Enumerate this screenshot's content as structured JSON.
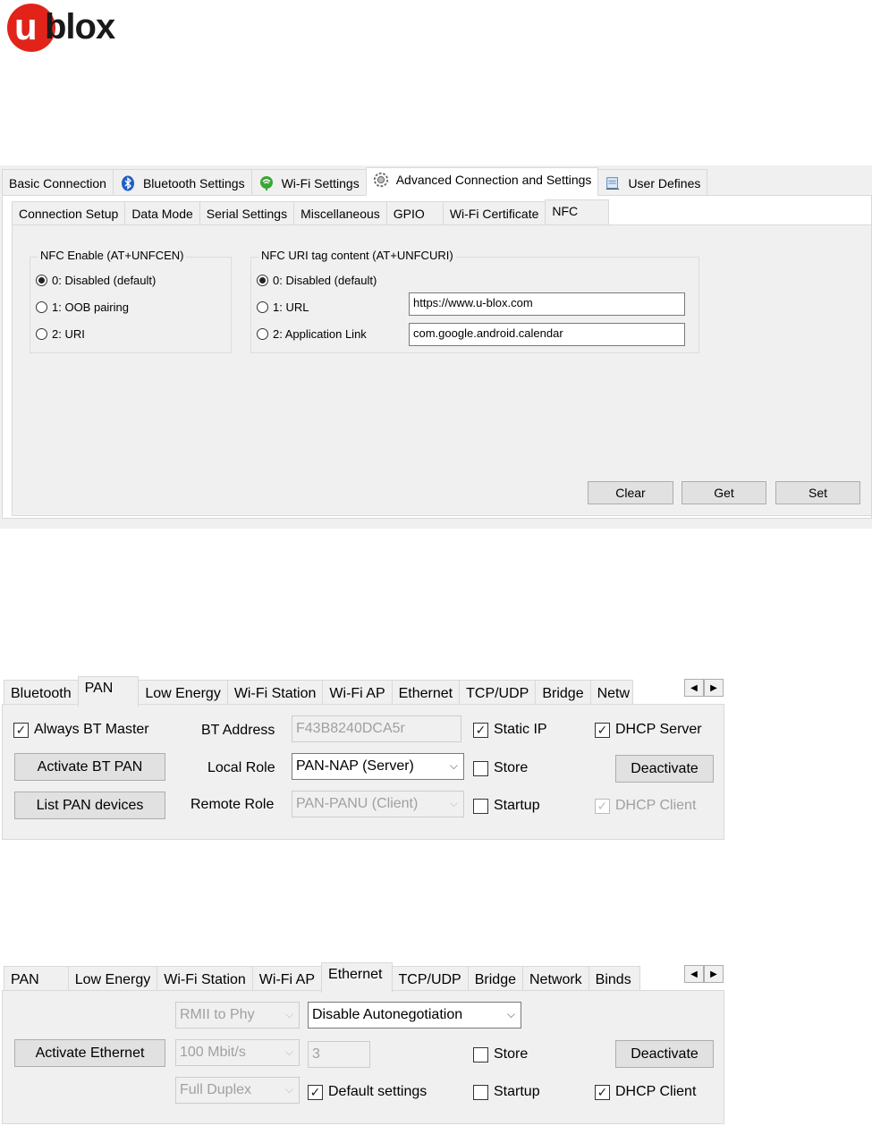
{
  "logo": {
    "text": "blox",
    "u": "u"
  },
  "panel1": {
    "tabs": [
      {
        "label": "Basic Connection",
        "icon": ""
      },
      {
        "label": "Bluetooth Settings",
        "icon": "bluetooth-icon"
      },
      {
        "label": "Wi-Fi Settings",
        "icon": "wifi-icon"
      },
      {
        "label": "Advanced Connection and Settings",
        "icon": "gear-icon"
      },
      {
        "label": "User Defines",
        "icon": "notepad-icon"
      }
    ],
    "subtabs": [
      "Connection Setup",
      "Data Mode",
      "Serial Settings",
      "Miscellaneous",
      "GPIO",
      "Wi-Fi Certificate",
      "NFC"
    ],
    "nfc_enable": {
      "title": "NFC Enable (AT+UNFCEN)",
      "options": [
        "0: Disabled (default)",
        "1: OOB pairing",
        "2: URI"
      ],
      "selected": 0
    },
    "nfc_uri": {
      "title": "NFC URI tag content (AT+UNFCURI)",
      "options": [
        "0: Disabled (default)",
        "1: URL",
        "2: Application Link"
      ],
      "selected": 0,
      "url_value": "https://www.u-blox.com",
      "app_link_value": "com.google.android.calendar"
    },
    "buttons": {
      "clear": "Clear",
      "get": "Get",
      "set": "Set"
    }
  },
  "panel2": {
    "tabs": [
      "Bluetooth",
      "PAN",
      "Low Energy",
      "Wi-Fi Station",
      "Wi-Fi AP",
      "Ethernet",
      "TCP/UDP",
      "Bridge",
      "Netw"
    ],
    "always_bt_master": "Always BT Master",
    "activate_bt_pan": "Activate BT PAN",
    "list_pan_devices": "List PAN devices",
    "bt_address_label": "BT Address",
    "bt_address_value": "F43B8240DCA5r",
    "local_role_label": "Local Role",
    "local_role_value": "PAN-NAP (Server)",
    "remote_role_label": "Remote Role",
    "remote_role_value": "PAN-PANU (Client)",
    "static_ip": "Static IP",
    "store": "Store",
    "startup": "Startup",
    "dhcp_server": "DHCP Server",
    "deactivate": "Deactivate",
    "dhcp_client": "DHCP Client"
  },
  "panel3": {
    "tabs": [
      "PAN",
      "Low Energy",
      "Wi-Fi Station",
      "Wi-Fi AP",
      "Ethernet",
      "TCP/UDP",
      "Bridge",
      "Network",
      "Binds"
    ],
    "rmii_value": "RMII to Phy",
    "autoneg_value": "Disable Autonegotiation",
    "activate_ethernet": "Activate Ethernet",
    "speed_value": "100 Mbit/s",
    "field_value": "3",
    "store": "Store",
    "deactivate": "Deactivate",
    "duplex_value": "Full Duplex",
    "default_settings": "Default settings",
    "startup": "Startup",
    "dhcp_client": "DHCP Client"
  }
}
